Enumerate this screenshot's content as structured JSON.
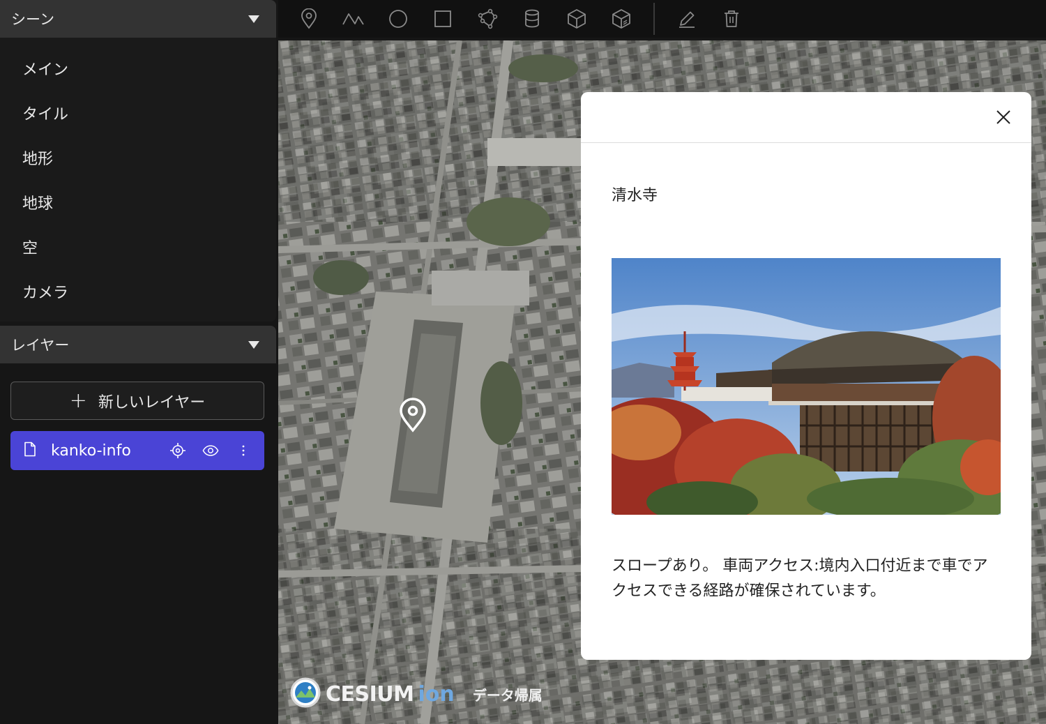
{
  "sidebar": {
    "scene": {
      "title": "シーン",
      "items": [
        {
          "label": "メイン"
        },
        {
          "label": "タイル"
        },
        {
          "label": "地形"
        },
        {
          "label": "地球"
        },
        {
          "label": "空"
        },
        {
          "label": "カメラ"
        }
      ]
    },
    "layers": {
      "title": "レイヤー",
      "new_layer_label": "新しいレイヤー",
      "items": [
        {
          "name": "kanko-info",
          "icon": "file-icon",
          "selected": true
        }
      ]
    }
  },
  "toolbar": {
    "tools": [
      "marker-icon",
      "polyline-icon",
      "circle-icon",
      "rectangle-icon",
      "polygon-icon",
      "cylinder-icon",
      "box-icon",
      "extruded-polygon-icon",
      "edit-icon",
      "delete-icon"
    ]
  },
  "map": {
    "credit_brand": "CESIUM",
    "credit_ion": "ion",
    "credit_attribution": "データ帰属"
  },
  "popup": {
    "title": "清水寺",
    "description": "スロープあり。 車両アクセス:境内入口付近まで車でアクセスできる経路が確保されています。"
  },
  "colors": {
    "accent": "#4a44d6",
    "panel_header": "#333333",
    "background": "#161616"
  }
}
